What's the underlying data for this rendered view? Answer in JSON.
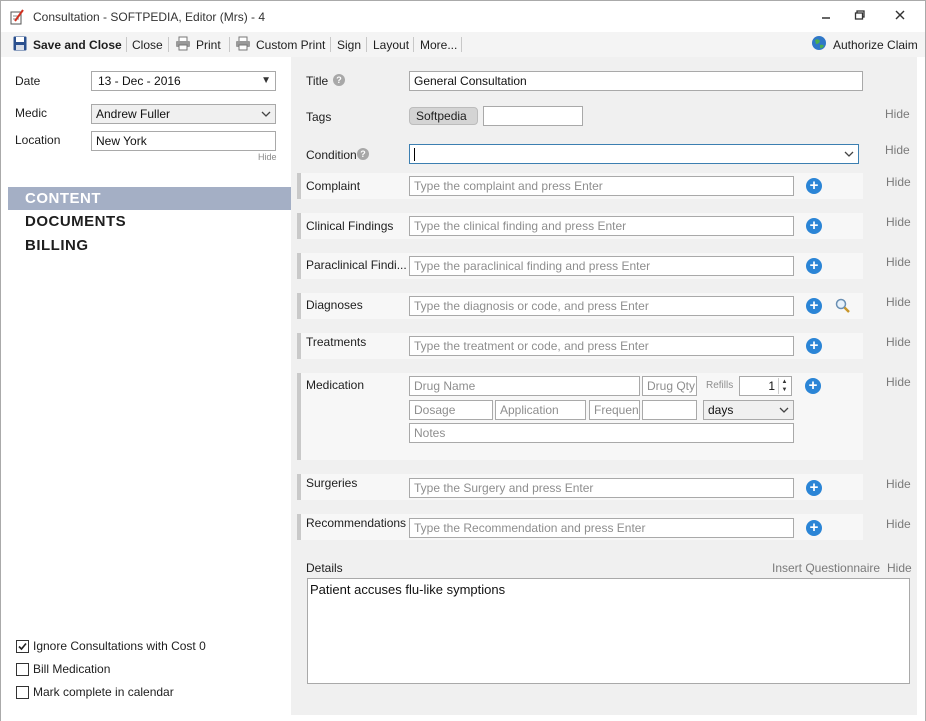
{
  "window": {
    "title": "Consultation - SOFTPEDIA, Editor (Mrs) - 4",
    "minimize": "🗕",
    "maximize": "🗖",
    "close": "✕"
  },
  "toolbar": {
    "save_close": "Save and Close",
    "close": "Close",
    "print": "Print",
    "custom_print": "Custom Print",
    "sign": "Sign",
    "layout": "Layout",
    "more": "More...",
    "authorize": "Authorize Claim",
    "watermark": "SOFTPEDIA"
  },
  "left": {
    "date_label": "Date",
    "date_value": "13 - Dec - 2016",
    "medic_label": "Medic",
    "medic_value": "Andrew Fuller",
    "location_label": "Location",
    "location_value": "New York",
    "hide": "Hide",
    "nav": [
      "CONTENT",
      "DOCUMENTS",
      "BILLING"
    ],
    "checkboxes": [
      {
        "label": "Ignore Consultations with Cost 0",
        "checked": true
      },
      {
        "label": "Bill Medication",
        "checked": false
      },
      {
        "label": "Mark complete in calendar",
        "checked": false
      }
    ]
  },
  "right": {
    "title_label": "Title",
    "title_value": "General Consultation",
    "tags_label": "Tags",
    "tag_chip": "Softpedia",
    "condition_label": "Condition",
    "hide": "Hide",
    "complaint_label": "Complaint",
    "complaint_ph": "Type the complaint and press Enter",
    "clinical_label": "Clinical Findings",
    "clinical_ph": "Type the clinical finding and press Enter",
    "paraclinical_label": "Paraclinical Findi...",
    "paraclinical_ph": "Type the paraclinical finding and press Enter",
    "diagnoses_label": "Diagnoses",
    "diagnoses_ph": "Type the diagnosis or code, and press Enter",
    "treatments_label": "Treatments",
    "treatments_ph": "Type the treatment or code, and press Enter",
    "medication_label": "Medication",
    "med_drug_ph": "Drug Name",
    "med_qty_ph": "Drug Qty",
    "med_refills": "Refills",
    "med_refills_value": "1",
    "med_dosage_ph": "Dosage",
    "med_application_ph": "Application",
    "med_frequency_ph": "Frequency",
    "med_days": "days",
    "med_notes_ph": "Notes",
    "surgeries_label": "Surgeries",
    "surgeries_ph": "Type the Surgery and press Enter",
    "recommendations_label": "Recommendations",
    "recommendations_ph": "Type the Recommendation and press Enter",
    "details_label": "Details",
    "insert_questionnaire": "Insert Questionnaire",
    "details_text": "Patient accuses flu-like symptions"
  },
  "colors": {
    "nav_selected": "#a4afc5",
    "plus_button": "#2b85d6",
    "condition_border": "#3c7fb1"
  }
}
